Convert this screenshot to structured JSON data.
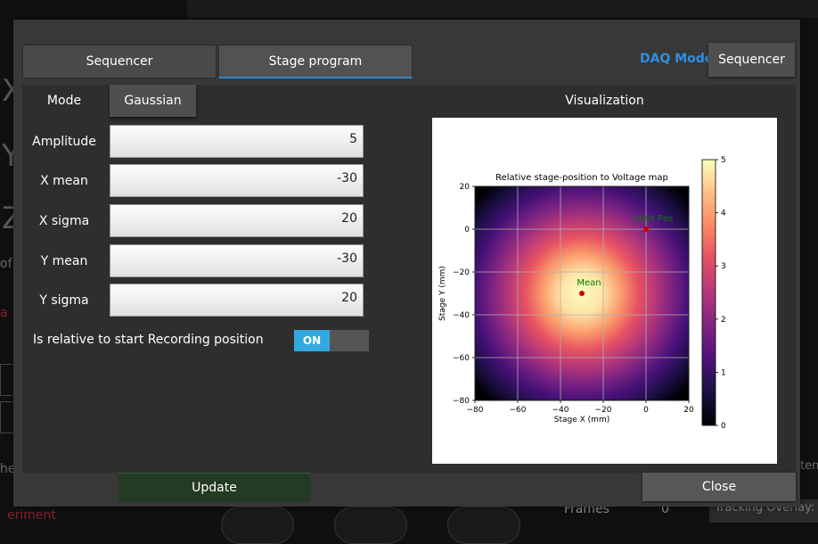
{
  "background": {
    "letters": [
      "X",
      "Y",
      "Z"
    ],
    "partial_of": "of",
    "partial_a": "a",
    "partial_he": "he",
    "partial_periment": "eriment",
    "frames_label": "Frames",
    "frames_value": "0",
    "tracking_overlay": "Tracking Overlay:",
    "partial_ten": "ten"
  },
  "tabs": [
    {
      "label": "Sequencer"
    },
    {
      "label": "Stage program"
    }
  ],
  "daq": {
    "label": "DAQ Mode",
    "button": "Sequencer"
  },
  "form": {
    "mode_label": "Mode",
    "mode_value": "Gaussian",
    "amplitude_label": "Amplitude",
    "amplitude_value": "5",
    "xmean_label": "X mean",
    "xmean_value": "-30",
    "xsigma_label": "X sigma",
    "xsigma_value": "20",
    "ymean_label": "Y mean",
    "ymean_value": "-30",
    "ysigma_label": "Y sigma",
    "ysigma_value": "20",
    "relative_label": "Is relative to start Recording position",
    "relative_toggle": "ON"
  },
  "visualization": {
    "title": "Visualization"
  },
  "buttons": {
    "update": "Update",
    "close": "Close"
  },
  "colors": {
    "accent": "#2f8fe0",
    "toggle_on": "#33a9e0",
    "update_bg": "#223b22"
  },
  "chart_data": {
    "type": "heatmap",
    "title": "Relative stage-position to Voltage map",
    "xlabel": "Stage X (mm)",
    "ylabel": "Stage Y (mm)",
    "xlim": [
      -80,
      20
    ],
    "ylim": [
      -80,
      20
    ],
    "xticks": [
      "−80",
      "−60",
      "−40",
      "−20",
      "0",
      "20"
    ],
    "yticks": [
      "20",
      "0",
      "−20",
      "−40",
      "−60",
      "−80"
    ],
    "colorbar_ticks": [
      "5",
      "4",
      "3",
      "2",
      "1",
      "0"
    ],
    "colorbar_range": [
      0,
      5
    ],
    "grid": true,
    "colormap": "magma",
    "gaussian": {
      "amplitude": 5,
      "x_mean": -30,
      "x_sigma": 20,
      "y_mean": -30,
      "y_sigma": 20
    },
    "points": [
      {
        "label": "Mean",
        "x": -30,
        "y": -30,
        "color": "#d00000",
        "label_color": "#008000"
      },
      {
        "label": "Start Pos",
        "x": 0,
        "y": 0,
        "color": "#d00000",
        "label_color": "#008000"
      }
    ]
  }
}
